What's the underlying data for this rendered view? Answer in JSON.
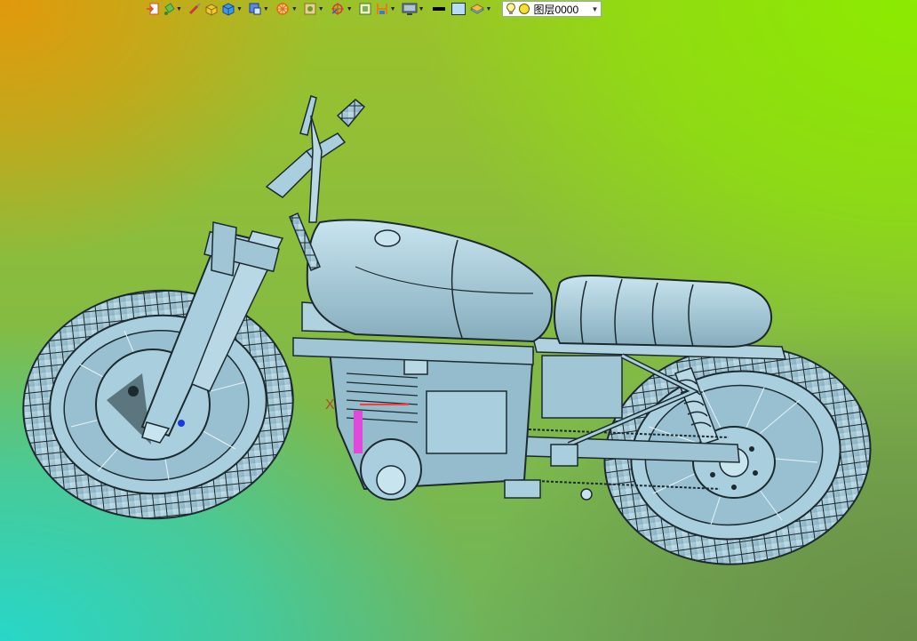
{
  "toolbar": {
    "buttons": [
      {
        "name": "insert-icon",
        "color": "#d84a2a"
      },
      {
        "name": "paint-bucket-icon",
        "color": "#2a8a3a"
      },
      {
        "name": "brush-icon",
        "color": "#c83a3a"
      },
      {
        "name": "box-icon",
        "color": "#e0b020"
      },
      {
        "name": "cube-icon",
        "color": "#2a7ad8"
      },
      {
        "name": "view-cube-icon",
        "color": "#3a5ab8"
      },
      {
        "name": "wheel-icon",
        "color": "#e06a10"
      },
      {
        "name": "render-icon",
        "color": "#c8a030"
      },
      {
        "name": "crosshair-icon",
        "color": "#d83a2a"
      },
      {
        "name": "frame-icon",
        "color": "#3a7a3a"
      },
      {
        "name": "section-icon",
        "color": "#e0801a"
      },
      {
        "name": "monitor-icon",
        "color": "#506070"
      },
      {
        "name": "line-color-icon",
        "color": "#000000"
      },
      {
        "name": "fill-color-icon",
        "color": "#b8dcf4"
      },
      {
        "name": "layers-icon",
        "color": "#3a9ad8"
      }
    ],
    "layer": {
      "bulb_icon": "lightbulb-icon",
      "dot_icon": "layer-color-dot-icon",
      "name": "图层0000"
    }
  },
  "viewport": {
    "axis_label": "X"
  },
  "colors": {
    "model_fill": "#a9cfde",
    "model_stroke": "#1c2a30"
  }
}
